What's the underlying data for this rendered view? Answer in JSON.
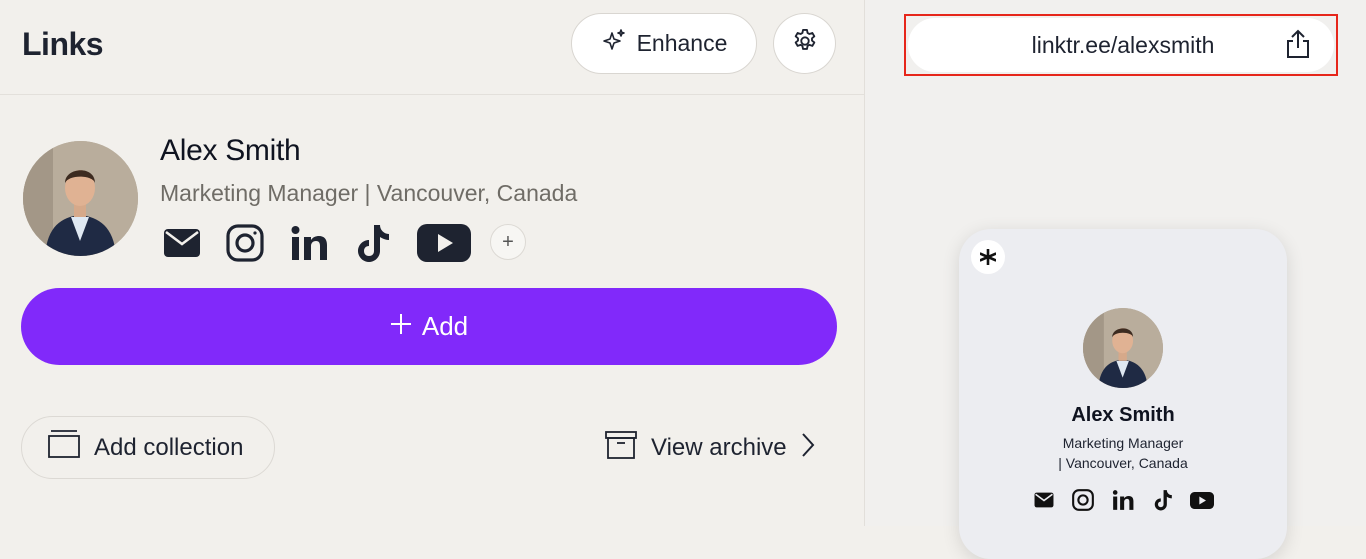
{
  "header": {
    "title": "Links",
    "enhance_label": "Enhance",
    "enhance_icon": "sparkle-icon",
    "settings_icon": "gear-icon"
  },
  "profile": {
    "name": "Alex Smith",
    "bio": "Marketing Manager | Vancouver, Canada",
    "socials": [
      "email-icon",
      "instagram-icon",
      "linkedin-icon",
      "tiktok-icon",
      "youtube-icon"
    ],
    "add_social_symbol": "+"
  },
  "actions": {
    "add_label": "Add",
    "add_symbol": "+",
    "add_collection_label": "Add collection",
    "view_archive_label": "View archive"
  },
  "preview": {
    "url": "linktr.ee/alexsmith",
    "name": "Alex Smith",
    "bio_line1": "Marketing Manager",
    "bio_line2": "| Vancouver, Canada"
  },
  "colors": {
    "accent": "#8129fa",
    "highlight_border": "#e6261a",
    "background": "#f2f0ec"
  }
}
